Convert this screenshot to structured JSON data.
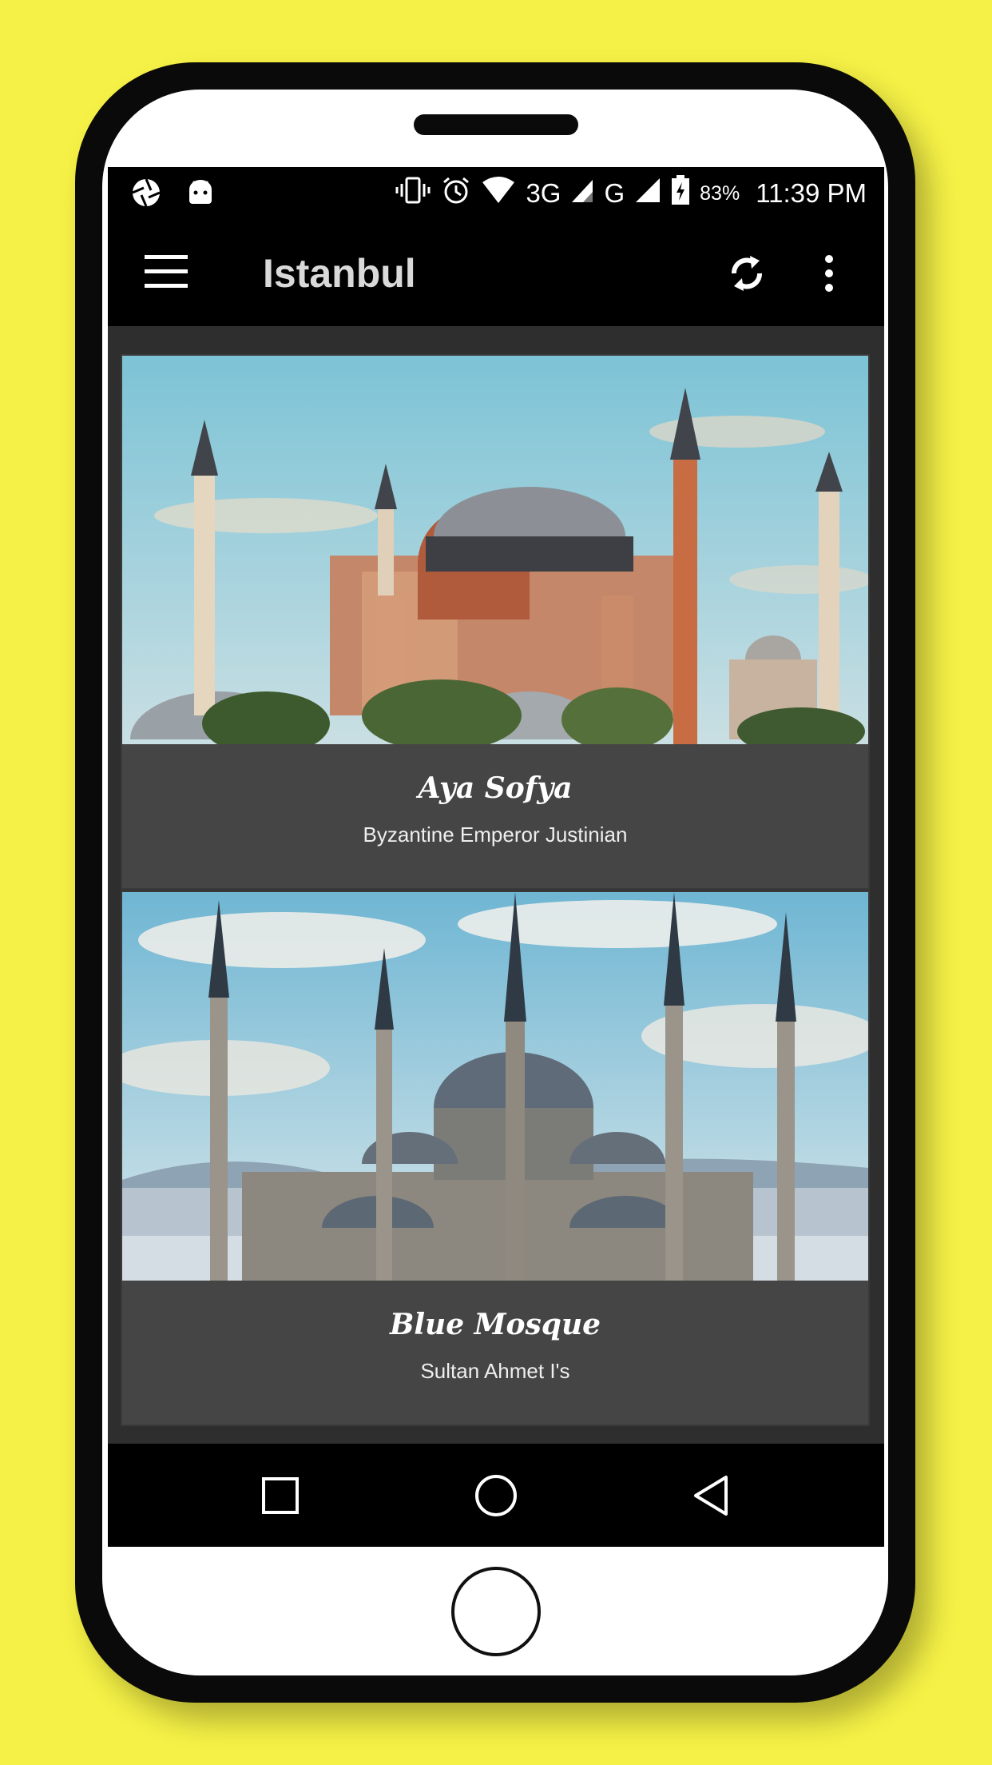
{
  "status_bar": {
    "battery_percent": "83%",
    "time": "11:39 PM",
    "network_1": "3G",
    "network_2": "G",
    "icons": [
      "aperture-icon",
      "android-icon",
      "vibrate-icon",
      "alarm-icon",
      "wifi-icon",
      "signal-icon",
      "battery-charging-icon"
    ]
  },
  "app_bar": {
    "title": "Istanbul",
    "icons": [
      "menu-icon",
      "refresh-icon",
      "more-vert-icon"
    ]
  },
  "cards": [
    {
      "title": "Aya Sofya",
      "subtitle": "Byzantine Emperor Justinian",
      "image": "hagia-sophia-photo"
    },
    {
      "title": "Blue Mosque",
      "subtitle": "Sultan Ahmet I's",
      "image": "blue-mosque-photo"
    }
  ],
  "nav_bar": {
    "icons": [
      "recents-square-icon",
      "home-circle-icon",
      "back-triangle-icon"
    ]
  },
  "colors": {
    "background": "#f5f146",
    "app_bar": "#000000",
    "card": "#454545",
    "screen": "#2e2e2e"
  }
}
